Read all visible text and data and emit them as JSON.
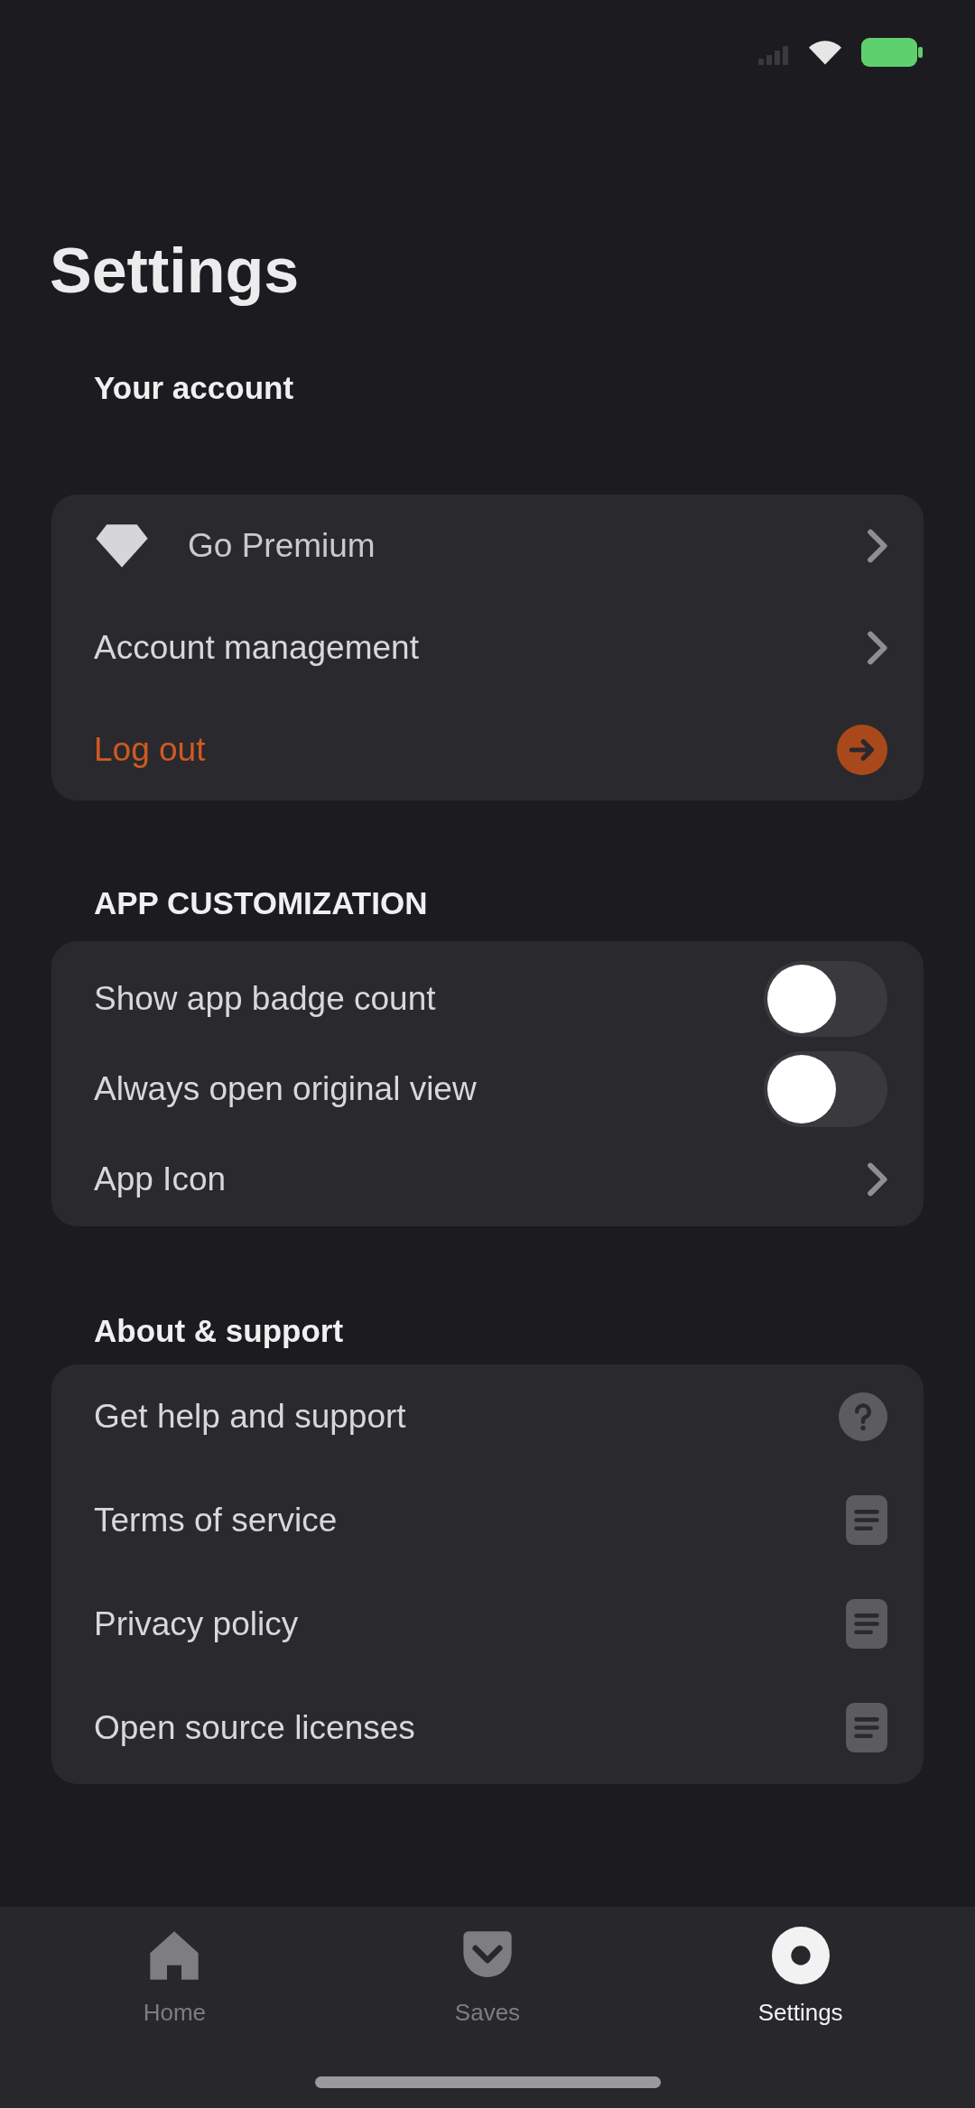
{
  "title": "Settings",
  "sections": [
    {
      "header": "Your account",
      "rows": [
        {
          "kind": "premium",
          "label": "Go Premium"
        },
        {
          "kind": "link",
          "label": "Account management"
        },
        {
          "kind": "logout",
          "label": "Log out"
        }
      ]
    },
    {
      "header": "APP CUSTOMIZATION",
      "rows": [
        {
          "kind": "toggle",
          "label": "Show app badge count",
          "on": false
        },
        {
          "kind": "toggle",
          "label": "Always open original view",
          "on": false
        },
        {
          "kind": "link",
          "label": "App Icon"
        }
      ]
    },
    {
      "header": "About & support",
      "rows": [
        {
          "kind": "help",
          "label": "Get help and support"
        },
        {
          "kind": "document",
          "label": "Terms of service"
        },
        {
          "kind": "document",
          "label": "Privacy policy"
        },
        {
          "kind": "document",
          "label": "Open source licenses"
        }
      ]
    }
  ],
  "tabs": [
    {
      "label": "Home",
      "selected": false
    },
    {
      "label": "Saves",
      "selected": false
    },
    {
      "label": "Settings",
      "selected": true
    }
  ]
}
